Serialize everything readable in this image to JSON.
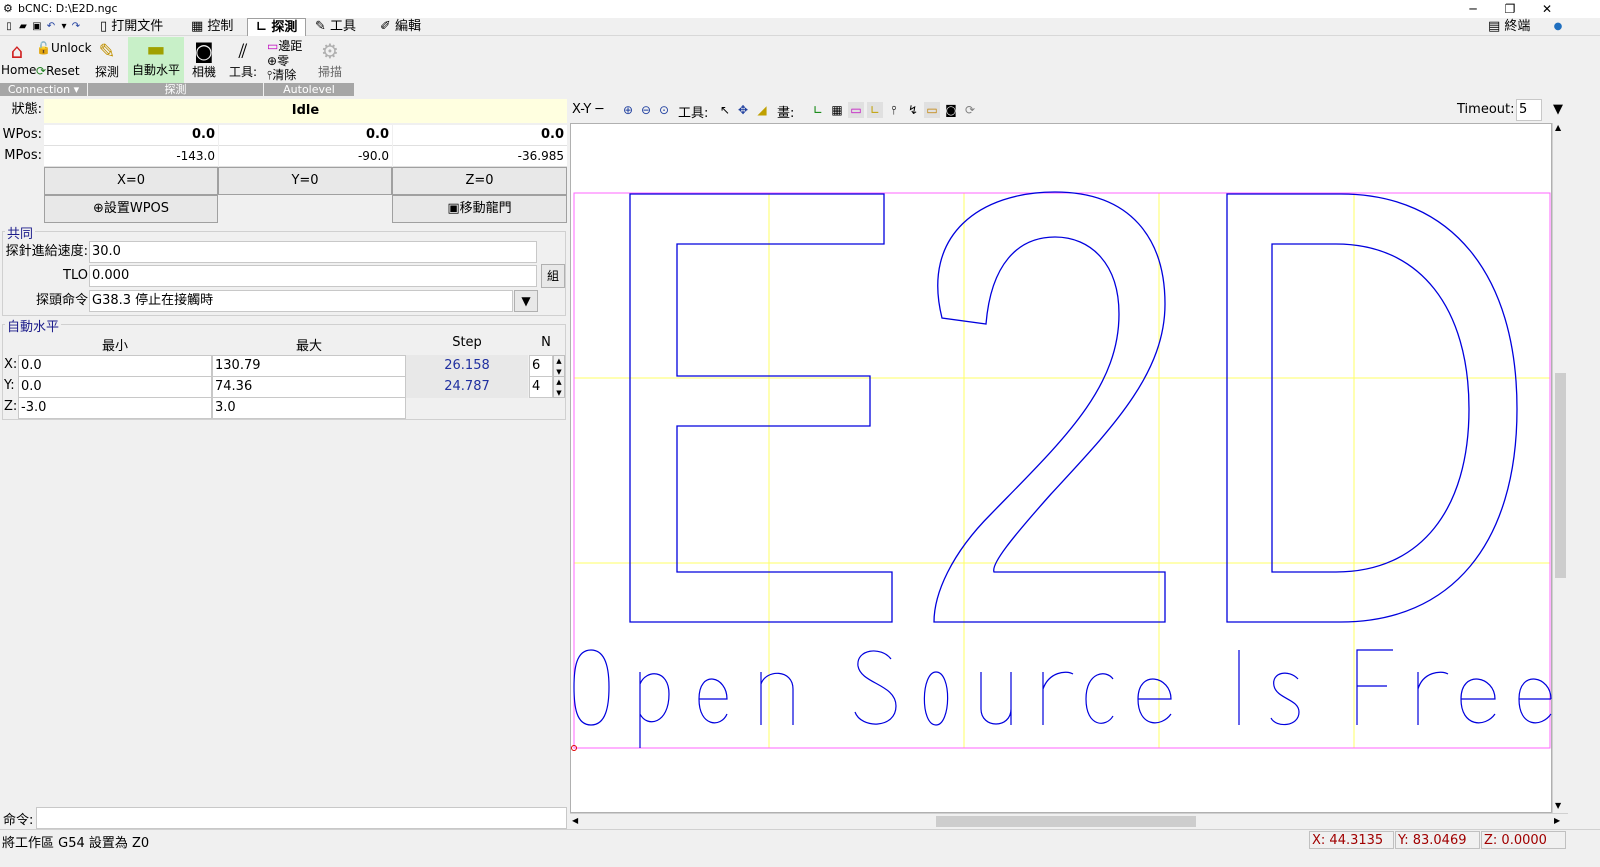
{
  "window": {
    "title": "bCNC: D:\\E2D.ngc"
  },
  "menu_tabs": [
    {
      "label": "打開文件"
    },
    {
      "label": "控制"
    },
    {
      "label": "探測"
    },
    {
      "label": "工具"
    },
    {
      "label": "編輯"
    }
  ],
  "terminal_label": "終端",
  "ribbon": {
    "connection": {
      "home": "Home",
      "unlock": "Unlock",
      "reset": "Reset",
      "group": "Connection"
    },
    "probe": {
      "probe": "探測",
      "autolevel": "自動水平",
      "camera": "相機",
      "tool": "工具:",
      "group": "探測"
    },
    "autolevel": {
      "margins": "邊距",
      "zero": "零",
      "clear": "清除",
      "scan": "掃描",
      "group": "Autolevel"
    }
  },
  "state": {
    "status_label": "狀態:",
    "status_value": "Idle",
    "wpos_label": "WPos:",
    "wpos": [
      "0.0",
      "0.0",
      "0.0"
    ],
    "mpos_label": "MPos:",
    "mpos": [
      "-143.0",
      "-90.0",
      "-36.985"
    ],
    "zero_buttons": [
      "X=0",
      "Y=0",
      "Z=0"
    ],
    "set_wpos": "設置WPOS",
    "move_gantry": "移動龍門"
  },
  "common": {
    "title": "共同",
    "feed_label": "探針進給速度:",
    "feed_value": "30.0",
    "tlo_label": "TLO",
    "tlo_value": "0.000",
    "tlo_button": "組",
    "cmd_label": "探頭命令",
    "cmd_value": "G38.3 停止在接觸時"
  },
  "autolevel_panel": {
    "title": "自動水平",
    "headers": [
      "最小",
      "最大",
      "Step",
      "N"
    ],
    "rows": [
      {
        "axis": "X:",
        "min": "0.0",
        "max": "130.79",
        "step": "26.158",
        "n": "6"
      },
      {
        "axis": "Y:",
        "min": "0.0",
        "max": "74.36",
        "step": "24.787",
        "n": "4"
      },
      {
        "axis": "Z:",
        "min": "-3.0",
        "max": "3.0",
        "step": "",
        "n": ""
      }
    ]
  },
  "command": {
    "label": "命令:",
    "value": ""
  },
  "canvas_toolbar": {
    "view": "X-Y",
    "tools_label": "工具:",
    "draw_label": "畫:",
    "timeout_label": "Timeout:",
    "timeout_value": "5"
  },
  "canvas": {
    "big_text": "E2D",
    "sub_text": "Open Source Is Free",
    "colors": {
      "path": "#0000dd",
      "grid": "#ffff66",
      "margin": "#ff66ff"
    }
  },
  "status_bar": {
    "message": "將工作區 G54 設置為 Z0",
    "x": "X: 44.3135",
    "y": "Y: 83.0469",
    "z": "Z: 0.0000"
  }
}
